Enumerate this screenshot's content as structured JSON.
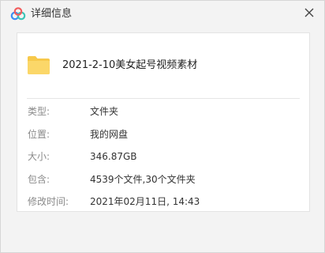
{
  "window": {
    "title": "详细信息",
    "app_icon": "cloud-icon",
    "close_icon": "close-icon"
  },
  "file": {
    "name": "2021-2-10美女起号视频素材",
    "icon": "folder-icon"
  },
  "details": [
    {
      "label": "类型:",
      "value": "文件夹"
    },
    {
      "label": "位置:",
      "value": "我的网盘"
    },
    {
      "label": "大小:",
      "value": "346.87GB"
    },
    {
      "label": "包含:",
      "value": "4539个文件,30个文件夹"
    },
    {
      "label": "修改时间:",
      "value": "2021年02月11日, 14:43"
    }
  ],
  "colors": {
    "folder": "#f7c94b",
    "cloud_blue": "#3b8ef3",
    "cloud_red": "#f25c5c",
    "cloud_teal": "#3cc4b7"
  }
}
